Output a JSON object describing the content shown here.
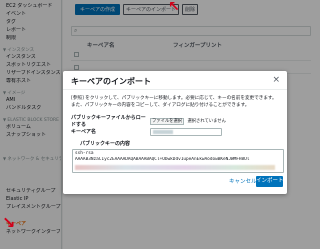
{
  "sidebar": {
    "items": [
      {
        "label": "EC2 ダッシュボード",
        "kind": "item"
      },
      {
        "label": "イベント",
        "kind": "item"
      },
      {
        "label": "タグ",
        "kind": "item"
      },
      {
        "label": "レポート",
        "kind": "item"
      },
      {
        "label": "制限",
        "kind": "item"
      },
      {
        "label": "インスタンス",
        "kind": "section"
      },
      {
        "label": "インスタンス",
        "kind": "item"
      },
      {
        "label": "スポットリクエスト",
        "kind": "item"
      },
      {
        "label": "リザーブドインスタンス",
        "kind": "item"
      },
      {
        "label": "専有ホスト",
        "kind": "item"
      },
      {
        "label": "イメージ",
        "kind": "section"
      },
      {
        "label": "AMI",
        "kind": "item"
      },
      {
        "label": "バンドルタスク",
        "kind": "item"
      },
      {
        "label": "ELASTIC BLOCK STORE",
        "kind": "section"
      },
      {
        "label": "ボリューム",
        "kind": "item"
      },
      {
        "label": "スナップショット",
        "kind": "item"
      },
      {
        "label": "ネットワーク & セキュリティ",
        "kind": "section"
      },
      {
        "label": "セキュリティグループ",
        "kind": "item"
      },
      {
        "label": "Elastic IP",
        "kind": "item"
      },
      {
        "label": "プレイスメントグループ",
        "kind": "item"
      },
      {
        "label": "キーペア",
        "kind": "item",
        "active": true
      },
      {
        "label": "ネットワークインターフェイス",
        "kind": "item"
      }
    ]
  },
  "toolbar": {
    "create_label": "キーペアの作成",
    "import_label": "キーペアのインポート",
    "delete_label": "削除"
  },
  "table": {
    "headers": [
      "キーペア名",
      "フィンガープリント"
    ]
  },
  "modal": {
    "title": "キーペアのインポート",
    "close": "×",
    "description": "[参照] をクリックして、パブリックキーに移動します。必要に応じて、キーの名前を変更できます。また、パブリックキーの内容をコピーして、ダイアログに貼り付けることができます。",
    "file_label": "パブリックキーファイルからロードする",
    "select_button": "ファイルを選択",
    "selected_file": "選択されていません",
    "keyname_label": "キーペア名",
    "content_label": "パブリックキーの内容",
    "key_text": "ssh-rsa",
    "key_body": "AAAAB3NzaC1yc2EAAAADAQABAAABAQCl+ObwkDdv1upeAnEkwAodowBKeNJWMFH8Ul",
    "cancel_label": "キャンセル",
    "import_label": "インポート"
  },
  "colors": {
    "primary": "#0073bb",
    "active_nav": "#ec7211",
    "annotation_arrow": "#d0021b"
  }
}
